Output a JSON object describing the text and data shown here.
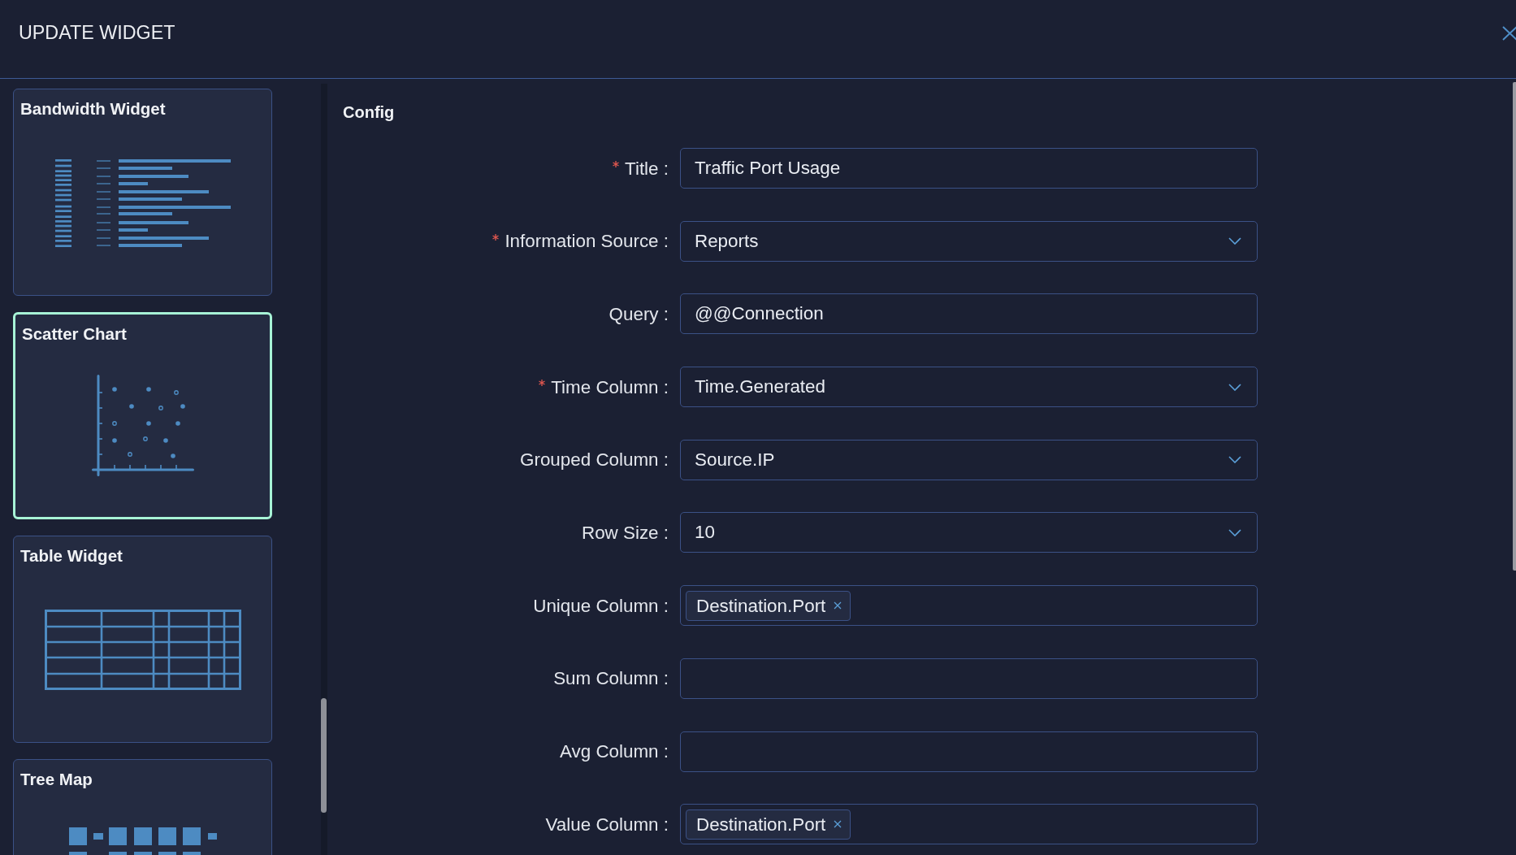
{
  "header": {
    "title": "UPDATE WIDGET"
  },
  "widget_types": [
    {
      "name": "Bandwidth Widget",
      "kind": "bandwidth",
      "selected": false
    },
    {
      "name": "Scatter Chart",
      "kind": "scatter",
      "selected": true
    },
    {
      "name": "Table Widget",
      "kind": "table",
      "selected": false
    },
    {
      "name": "Tree Map",
      "kind": "treemap",
      "selected": false
    }
  ],
  "config": {
    "heading": "Config",
    "fields": [
      {
        "label": "Title :",
        "required": true,
        "kind": "text",
        "value": "Traffic Port Usage"
      },
      {
        "label": "Information Source :",
        "required": true,
        "kind": "select",
        "value": "Reports"
      },
      {
        "label": "Query :",
        "required": false,
        "kind": "text",
        "value": "@@Connection"
      },
      {
        "label": "Time Column :",
        "required": true,
        "kind": "select",
        "value": "Time.Generated"
      },
      {
        "label": "Grouped Column :",
        "required": false,
        "kind": "select",
        "value": "Source.IP"
      },
      {
        "label": "Row Size :",
        "required": false,
        "kind": "select",
        "value": "10"
      },
      {
        "label": "Unique Column :",
        "required": false,
        "kind": "tags",
        "tags": [
          "Destination.Port"
        ]
      },
      {
        "label": "Sum Column :",
        "required": false,
        "kind": "tags"
      },
      {
        "label": "Avg Column :",
        "required": false,
        "kind": "tags"
      },
      {
        "label": "Value Column :",
        "required": false,
        "kind": "tags",
        "tags": [
          "Destination.Port"
        ]
      }
    ]
  }
}
